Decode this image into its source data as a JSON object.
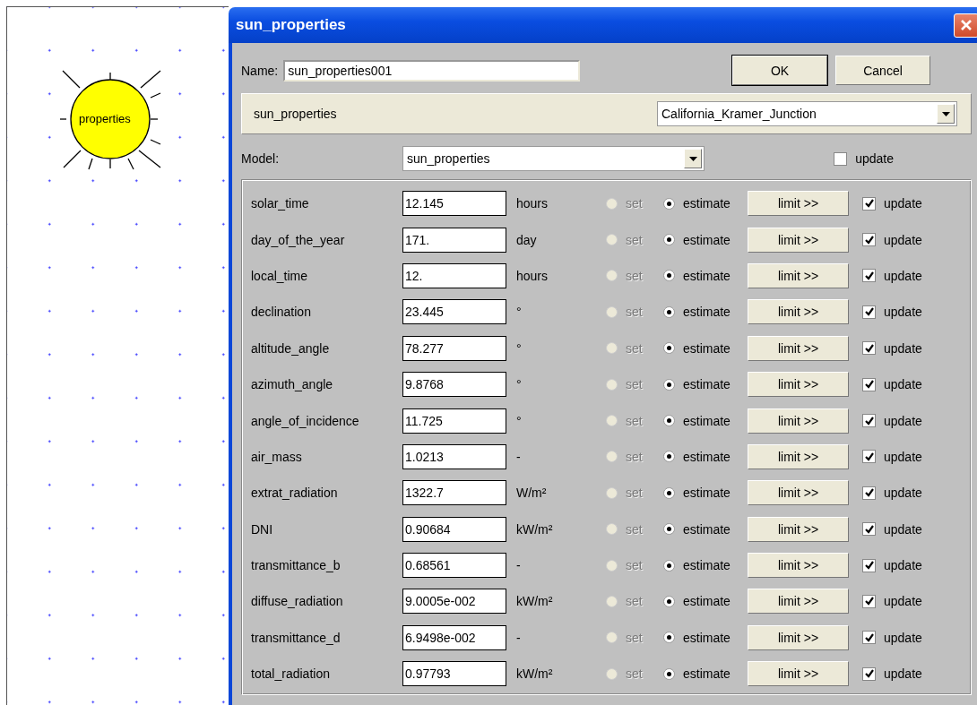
{
  "canvas": {
    "node": {
      "label": "properties"
    }
  },
  "dialog": {
    "title": "sun_properties",
    "name_label": "Name:",
    "name_value": "sun_properties001",
    "buttons": [
      {
        "label": "OK",
        "default": true
      },
      {
        "label": "Cancel",
        "default": false
      }
    ],
    "header": {
      "title": "sun_properties",
      "location": "California_Kramer_Junction"
    },
    "model": {
      "label": "Model:",
      "value": "sun_properties",
      "update": {
        "label": "update",
        "checked": false
      }
    },
    "parameters": [
      {
        "name": "solar_time",
        "value": "12.145",
        "unit": "hours",
        "set": {
          "label": "set",
          "selected": false,
          "disabled": true
        },
        "estimate": {
          "label": "estimate",
          "selected": true
        },
        "limit": "limit >>",
        "update": {
          "label": "update",
          "checked": true
        }
      },
      {
        "name": "day_of_the_year",
        "value": "171.",
        "unit": "day",
        "set": {
          "label": "set",
          "selected": false,
          "disabled": true
        },
        "estimate": {
          "label": "estimate",
          "selected": true
        },
        "limit": "limit >>",
        "update": {
          "label": "update",
          "checked": true
        }
      },
      {
        "name": "local_time",
        "value": "12.",
        "unit": "hours",
        "set": {
          "label": "set",
          "selected": false,
          "disabled": true
        },
        "estimate": {
          "label": "estimate",
          "selected": true
        },
        "limit": "limit >>",
        "update": {
          "label": "update",
          "checked": true
        }
      },
      {
        "name": "declination",
        "value": "23.445",
        "unit": "°",
        "set": {
          "label": "set",
          "selected": false,
          "disabled": true
        },
        "estimate": {
          "label": "estimate",
          "selected": true
        },
        "limit": "limit >>",
        "update": {
          "label": "update",
          "checked": true
        }
      },
      {
        "name": "altitude_angle",
        "value": "78.277",
        "unit": "°",
        "set": {
          "label": "set",
          "selected": false,
          "disabled": true
        },
        "estimate": {
          "label": "estimate",
          "selected": true
        },
        "limit": "limit >>",
        "update": {
          "label": "update",
          "checked": true
        }
      },
      {
        "name": "azimuth_angle",
        "value": "9.8768",
        "unit": "°",
        "set": {
          "label": "set",
          "selected": false,
          "disabled": true
        },
        "estimate": {
          "label": "estimate",
          "selected": true
        },
        "limit": "limit >>",
        "update": {
          "label": "update",
          "checked": true
        }
      },
      {
        "name": "angle_of_incidence",
        "value": "11.725",
        "unit": "°",
        "set": {
          "label": "set",
          "selected": false,
          "disabled": true
        },
        "estimate": {
          "label": "estimate",
          "selected": true
        },
        "limit": "limit >>",
        "update": {
          "label": "update",
          "checked": true
        }
      },
      {
        "name": "air_mass",
        "value": "1.0213",
        "unit": "-",
        "set": {
          "label": "set",
          "selected": false,
          "disabled": true
        },
        "estimate": {
          "label": "estimate",
          "selected": true
        },
        "limit": "limit >>",
        "update": {
          "label": "update",
          "checked": true
        }
      },
      {
        "name": "extrat_radiation",
        "value": "1322.7",
        "unit": "W/m²",
        "set": {
          "label": "set",
          "selected": false,
          "disabled": true
        },
        "estimate": {
          "label": "estimate",
          "selected": true
        },
        "limit": "limit >>",
        "update": {
          "label": "update",
          "checked": true
        }
      },
      {
        "name": "DNI",
        "value": "0.90684",
        "unit": "kW/m²",
        "set": {
          "label": "set",
          "selected": false,
          "disabled": true
        },
        "estimate": {
          "label": "estimate",
          "selected": true
        },
        "limit": "limit >>",
        "update": {
          "label": "update",
          "checked": true
        }
      },
      {
        "name": "transmittance_b",
        "value": "0.68561",
        "unit": "-",
        "set": {
          "label": "set",
          "selected": false,
          "disabled": true
        },
        "estimate": {
          "label": "estimate",
          "selected": true
        },
        "limit": "limit >>",
        "update": {
          "label": "update",
          "checked": true
        }
      },
      {
        "name": "diffuse_radiation",
        "value": "9.0005e-002",
        "unit": "kW/m²",
        "set": {
          "label": "set",
          "selected": false,
          "disabled": true
        },
        "estimate": {
          "label": "estimate",
          "selected": true
        },
        "limit": "limit >>",
        "update": {
          "label": "update",
          "checked": true
        }
      },
      {
        "name": "transmittance_d",
        "value": "6.9498e-002",
        "unit": "-",
        "set": {
          "label": "set",
          "selected": false,
          "disabled": true
        },
        "estimate": {
          "label": "estimate",
          "selected": true
        },
        "limit": "limit >>",
        "update": {
          "label": "update",
          "checked": true
        }
      },
      {
        "name": "total_radiation",
        "value": "0.97793",
        "unit": "kW/m²",
        "set": {
          "label": "set",
          "selected": false,
          "disabled": true
        },
        "estimate": {
          "label": "estimate",
          "selected": true
        },
        "limit": "limit >>",
        "update": {
          "label": "update",
          "checked": true
        }
      }
    ]
  }
}
